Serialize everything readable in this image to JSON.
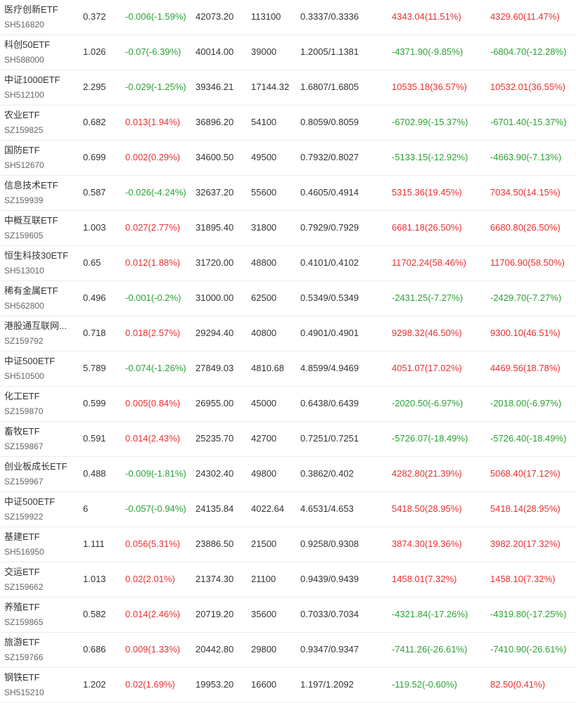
{
  "colors": {
    "up": "#e93030",
    "down": "#2aa233",
    "text": "#333333",
    "code": "#666666"
  },
  "rows": [
    {
      "name": "医疗创新ETF",
      "code": "SH516820",
      "price": "0.372",
      "change": "-0.006(-1.59%)",
      "change_dir": "down",
      "amount": "42073.20",
      "volume": "113100",
      "nav": "0.3337/0.3336",
      "profit1": "4343.04(11.51%)",
      "profit1_dir": "up",
      "profit2": "4329.60(11.47%)",
      "profit2_dir": "up"
    },
    {
      "name": "科创50ETF",
      "code": "SH588000",
      "price": "1.026",
      "change": "-0.07(-6.39%)",
      "change_dir": "down",
      "amount": "40014.00",
      "volume": "39000",
      "nav": "1.2005/1.1381",
      "profit1": "-4371.90(-9.85%)",
      "profit1_dir": "down",
      "profit2": "-6804.70(-12.28%)",
      "profit2_dir": "down"
    },
    {
      "name": "中证1000ETF",
      "code": "SH512100",
      "price": "2.295",
      "change": "-0.029(-1.25%)",
      "change_dir": "down",
      "amount": "39346.21",
      "volume": "17144.32",
      "nav": "1.6807/1.6805",
      "profit1": "10535.18(36.57%)",
      "profit1_dir": "up",
      "profit2": "10532.01(36.55%)",
      "profit2_dir": "up"
    },
    {
      "name": "农业ETF",
      "code": "SZ159825",
      "price": "0.682",
      "change": "0.013(1.94%)",
      "change_dir": "up",
      "amount": "36896.20",
      "volume": "54100",
      "nav": "0.8059/0.8059",
      "profit1": "-6702.99(-15.37%)",
      "profit1_dir": "down",
      "profit2": "-6701.40(-15.37%)",
      "profit2_dir": "down"
    },
    {
      "name": "国防ETF",
      "code": "SH512670",
      "price": "0.699",
      "change": "0.002(0.29%)",
      "change_dir": "up",
      "amount": "34600.50",
      "volume": "49500",
      "nav": "0.7932/0.8027",
      "profit1": "-5133.15(-12.92%)",
      "profit1_dir": "down",
      "profit2": "-4663.90(-7.13%)",
      "profit2_dir": "down"
    },
    {
      "name": "信息技术ETF",
      "code": "SZ159939",
      "price": "0.587",
      "change": "-0.026(-4.24%)",
      "change_dir": "down",
      "amount": "32637.20",
      "volume": "55600",
      "nav": "0.4605/0.4914",
      "profit1": "5315.36(19.45%)",
      "profit1_dir": "up",
      "profit2": "7034.50(14.15%)",
      "profit2_dir": "up"
    },
    {
      "name": "中概互联ETF",
      "code": "SZ159605",
      "price": "1.003",
      "change": "0.027(2.77%)",
      "change_dir": "up",
      "amount": "31895.40",
      "volume": "31800",
      "nav": "0.7929/0.7929",
      "profit1": "6681.18(26.50%)",
      "profit1_dir": "up",
      "profit2": "6680.80(26.50%)",
      "profit2_dir": "up"
    },
    {
      "name": "恒生科技30ETF",
      "code": "SH513010",
      "price": "0.65",
      "change": "0.012(1.88%)",
      "change_dir": "up",
      "amount": "31720.00",
      "volume": "48800",
      "nav": "0.4101/0.4102",
      "profit1": "11702.24(58.46%)",
      "profit1_dir": "up",
      "profit2": "11706.90(58.50%)",
      "profit2_dir": "up"
    },
    {
      "name": "稀有金属ETF",
      "code": "SH562800",
      "price": "0.496",
      "change": "-0.001(-0.2%)",
      "change_dir": "down",
      "amount": "31000.00",
      "volume": "62500",
      "nav": "0.5349/0.5349",
      "profit1": "-2431.25(-7.27%)",
      "profit1_dir": "down",
      "profit2": "-2429.70(-7.27%)",
      "profit2_dir": "down"
    },
    {
      "name": "港股通互联网...",
      "code": "SZ159792",
      "price": "0.718",
      "change": "0.018(2.57%)",
      "change_dir": "up",
      "amount": "29294.40",
      "volume": "40800",
      "nav": "0.4901/0.4901",
      "profit1": "9298.32(46.50%)",
      "profit1_dir": "up",
      "profit2": "9300.10(46.51%)",
      "profit2_dir": "up"
    },
    {
      "name": "中证500ETF",
      "code": "SH510500",
      "price": "5.789",
      "change": "-0.074(-1.26%)",
      "change_dir": "down",
      "amount": "27849.03",
      "volume": "4810.68",
      "nav": "4.8599/4.9469",
      "profit1": "4051.07(17.02%)",
      "profit1_dir": "up",
      "profit2": "4469.56(18.78%)",
      "profit2_dir": "up"
    },
    {
      "name": "化工ETF",
      "code": "SZ159870",
      "price": "0.599",
      "change": "0.005(0.84%)",
      "change_dir": "up",
      "amount": "26955.00",
      "volume": "45000",
      "nav": "0.6438/0.6439",
      "profit1": "-2020.50(-6.97%)",
      "profit1_dir": "down",
      "profit2": "-2018.00(-6.97%)",
      "profit2_dir": "down"
    },
    {
      "name": "畜牧ETF",
      "code": "SZ159867",
      "price": "0.591",
      "change": "0.014(2.43%)",
      "change_dir": "up",
      "amount": "25235.70",
      "volume": "42700",
      "nav": "0.7251/0.7251",
      "profit1": "-5726.07(-18.49%)",
      "profit1_dir": "down",
      "profit2": "-5726.40(-18.49%)",
      "profit2_dir": "down"
    },
    {
      "name": "创业板成长ETF",
      "code": "SZ159967",
      "price": "0.488",
      "change": "-0.009(-1.81%)",
      "change_dir": "down",
      "amount": "24302.40",
      "volume": "49800",
      "nav": "0.3862/0.402",
      "profit1": "4282.80(21.39%)",
      "profit1_dir": "up",
      "profit2": "5068.40(17.12%)",
      "profit2_dir": "up"
    },
    {
      "name": "中证500ETF",
      "code": "SZ159922",
      "price": "6",
      "change": "-0.057(-0.94%)",
      "change_dir": "down",
      "amount": "24135.84",
      "volume": "4022.64",
      "nav": "4.6531/4.653",
      "profit1": "5418.50(28.95%)",
      "profit1_dir": "up",
      "profit2": "5418.14(28.95%)",
      "profit2_dir": "up"
    },
    {
      "name": "基建ETF",
      "code": "SH516950",
      "price": "1.111",
      "change": "0.056(5.31%)",
      "change_dir": "up",
      "amount": "23886.50",
      "volume": "21500",
      "nav": "0.9258/0.9308",
      "profit1": "3874.30(19.36%)",
      "profit1_dir": "up",
      "profit2": "3982.20(17.32%)",
      "profit2_dir": "up"
    },
    {
      "name": "交运ETF",
      "code": "SZ159662",
      "price": "1.013",
      "change": "0.02(2.01%)",
      "change_dir": "up",
      "amount": "21374.30",
      "volume": "21100",
      "nav": "0.9439/0.9439",
      "profit1": "1458.01(7.32%)",
      "profit1_dir": "up",
      "profit2": "1458.10(7.32%)",
      "profit2_dir": "up"
    },
    {
      "name": "养殖ETF",
      "code": "SZ159865",
      "price": "0.582",
      "change": "0.014(2.46%)",
      "change_dir": "up",
      "amount": "20719.20",
      "volume": "35600",
      "nav": "0.7033/0.7034",
      "profit1": "-4321.84(-17.26%)",
      "profit1_dir": "down",
      "profit2": "-4319.80(-17.25%)",
      "profit2_dir": "down"
    },
    {
      "name": "旅游ETF",
      "code": "SZ159766",
      "price": "0.686",
      "change": "0.009(1.33%)",
      "change_dir": "up",
      "amount": "20442.80",
      "volume": "29800",
      "nav": "0.9347/0.9347",
      "profit1": "-7411.26(-26.61%)",
      "profit1_dir": "down",
      "profit2": "-7410.90(-26.61%)",
      "profit2_dir": "down"
    },
    {
      "name": "钢铁ETF",
      "code": "SH515210",
      "price": "1.202",
      "change": "0.02(1.69%)",
      "change_dir": "up",
      "amount": "19953.20",
      "volume": "16600",
      "nav": "1.197/1.2092",
      "profit1": "-119.52(-0.60%)",
      "profit1_dir": "down",
      "profit2": "82.50(0.41%)",
      "profit2_dir": "up"
    }
  ]
}
